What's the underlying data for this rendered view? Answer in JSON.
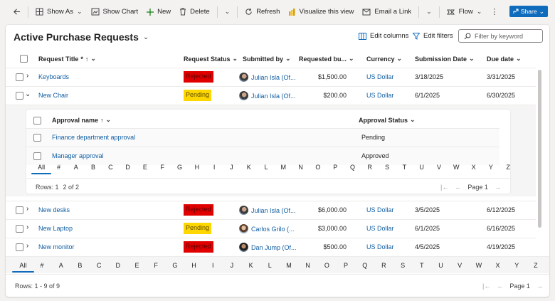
{
  "toolbar": {
    "show_as": "Show As",
    "show_chart": "Show Chart",
    "new": "New",
    "delete": "Delete",
    "refresh": "Refresh",
    "visualize": "Visualize this view",
    "email_link": "Email a Link",
    "flow": "Flow",
    "share": "Share"
  },
  "view": {
    "title": "Active Purchase Requests",
    "edit_columns": "Edit columns",
    "edit_filters": "Edit filters",
    "filter_placeholder": "Filter by keyword"
  },
  "columns": {
    "title": "Request Title",
    "required_mark": "*",
    "status": "Request Status",
    "submitted_by": "Submitted by",
    "requested_budget": "Requested bu...",
    "currency": "Currency",
    "submission_date": "Submission Date",
    "due_date": "Due date"
  },
  "rows": [
    {
      "title": "Keyboards",
      "status": "Rejected",
      "status_color": "#e10000",
      "submitter": "Julian Isla (Of...",
      "budget": "$1,500.00",
      "currency": "US Dollar",
      "submitted": "3/18/2025",
      "due": "3/31/2025"
    },
    {
      "title": "New Chair",
      "status": "Pending",
      "status_color": "#ffd700",
      "submitter": "Julian Isla (Of...",
      "budget": "$200.00",
      "currency": "US Dollar",
      "submitted": "6/1/2025",
      "due": "6/30/2025"
    },
    {
      "title": "New desks",
      "status": "Rejected",
      "status_color": "#e10000",
      "submitter": "Julian Isla (Of...",
      "budget": "$6,000.00",
      "currency": "US Dollar",
      "submitted": "3/5/2025",
      "due": "6/12/2025"
    },
    {
      "title": "New Laptop",
      "status": "Pending",
      "status_color": "#ffd700",
      "submitter": "Carlos Grilo (...",
      "budget": "$3,000.00",
      "currency": "US Dollar",
      "submitted": "6/1/2025",
      "due": "6/16/2025"
    },
    {
      "title": "New monitor",
      "status": "Rejected",
      "status_color": "#e10000",
      "submitter": "Dan Jump (Of...",
      "budget": "$500.00",
      "currency": "US Dollar",
      "submitted": "4/5/2025",
      "due": "4/19/2025"
    }
  ],
  "subgrid": {
    "col_name": "Approval name",
    "col_status": "Approval Status",
    "rows": [
      {
        "name": "Finance department approval",
        "status": "Pending"
      },
      {
        "name": "Manager approval",
        "status": "Approved"
      }
    ],
    "rows_label": "Rows: 1",
    "rows_of": "2 of 2",
    "page": "Page 1"
  },
  "alphabet": [
    "All",
    "#",
    "A",
    "B",
    "C",
    "D",
    "E",
    "F",
    "G",
    "H",
    "I",
    "J",
    "K",
    "L",
    "M",
    "N",
    "O",
    "P",
    "Q",
    "R",
    "S",
    "T",
    "U",
    "V",
    "W",
    "X",
    "Y",
    "Z"
  ],
  "footer": {
    "rows_label": "Rows: 1 - 9 of 9",
    "page": "Page 1"
  }
}
